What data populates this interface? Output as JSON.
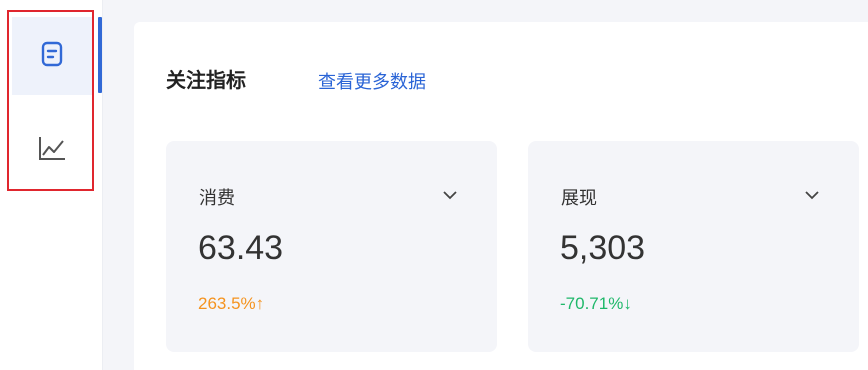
{
  "sidebar": {
    "items": [
      {
        "icon": "document-icon",
        "active": true
      },
      {
        "icon": "line-chart-icon",
        "active": false
      }
    ]
  },
  "section": {
    "title": "关注指标",
    "link": "查看更多数据"
  },
  "metrics": [
    {
      "label": "消费",
      "value": "63.43",
      "change": "263.5%↑",
      "change_color": "#f5931f"
    },
    {
      "label": "展现",
      "value": "5,303",
      "change": "-70.71%↓",
      "change_color": "#1fb86a"
    }
  ],
  "colors": {
    "accent": "#3169d6",
    "highlight": "#e0262e",
    "up": "#f5931f",
    "down": "#1fb86a"
  }
}
